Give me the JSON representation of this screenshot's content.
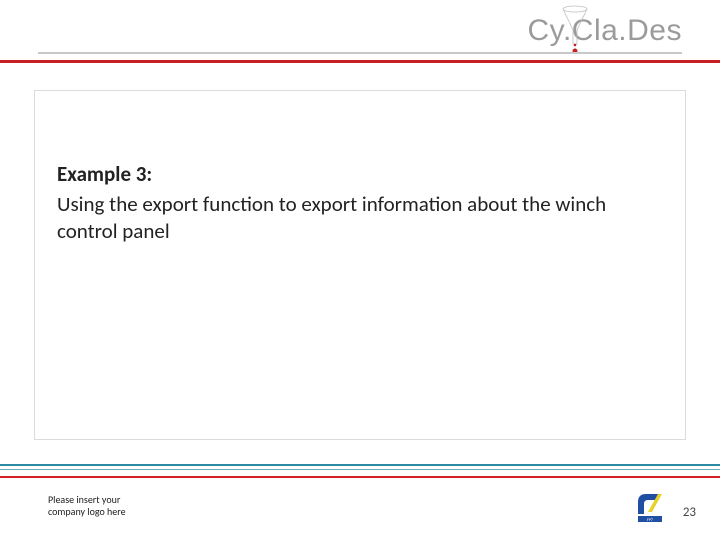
{
  "brand": {
    "text": "Cy.Cla.Des"
  },
  "content": {
    "title": "Example 3:",
    "body": "Using the export function to export information about the winch control panel"
  },
  "footer": {
    "note_line1": "Please insert your",
    "note_line2": "company logo here",
    "fp7_label": "FP7",
    "page_number": "23"
  },
  "colors": {
    "accent_red": "#c62026",
    "footer_teal": "#2b8aa0",
    "brand_gray": "#9b9b9b"
  }
}
